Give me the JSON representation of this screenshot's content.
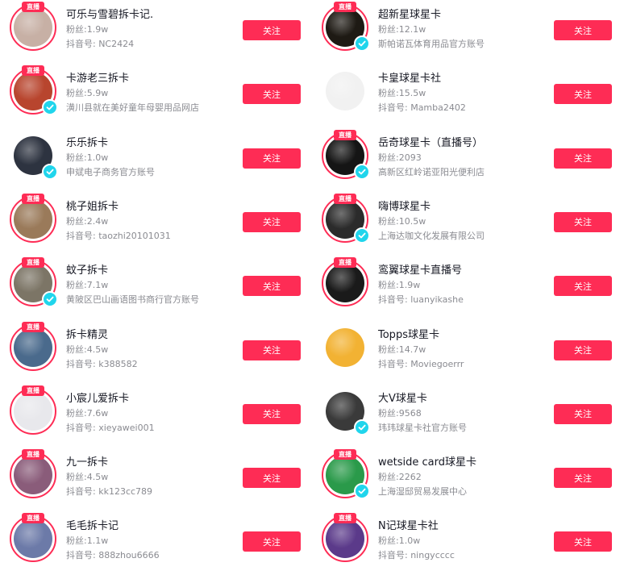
{
  "follow_label": "关注",
  "live_label": "直播",
  "left": [
    {
      "name": "可乐与雪碧拆卡记.",
      "fans": "粉丝:1.9w",
      "line3": "抖音号: NC2424",
      "live": true,
      "verified": false,
      "avatar_color": "#c7b0a5"
    },
    {
      "name": "卡游老三拆卡",
      "fans": "粉丝:5.9w",
      "line3": "潢川县就在美好童年母婴用品网店",
      "live": true,
      "verified": true,
      "avatar_color": "#b8452e"
    },
    {
      "name": "乐乐拆卡",
      "fans": "粉丝:1.0w",
      "line3": "申斌电子商务官方账号",
      "live": false,
      "verified": true,
      "avatar_color": "#2d3340"
    },
    {
      "name": "桃子姐拆卡",
      "fans": "粉丝:2.4w",
      "line3": "抖音号: taozhi20101031",
      "live": true,
      "verified": false,
      "avatar_color": "#9a7a5a"
    },
    {
      "name": "蚊子拆卡",
      "fans": "粉丝:7.1w",
      "line3": "黄陂区巴山画语图书商行官方账号",
      "live": true,
      "verified": true,
      "avatar_color": "#7c7566"
    },
    {
      "name": "拆卡精灵",
      "fans": "粉丝:4.5w",
      "line3": "抖音号: k388582",
      "live": true,
      "verified": false,
      "avatar_color": "#4a6a8c"
    },
    {
      "name": "小宸儿爱拆卡",
      "fans": "粉丝:7.6w",
      "line3": "抖音号: xieyawei001",
      "live": true,
      "verified": false,
      "avatar_color": "#e8e8ec"
    },
    {
      "name": "九一拆卡",
      "fans": "粉丝:4.5w",
      "line3": "抖音号: kk123cc789",
      "live": true,
      "verified": false,
      "avatar_color": "#8a5c7a"
    },
    {
      "name": "毛毛拆卡记",
      "fans": "粉丝:1.1w",
      "line3": "抖音号: 888zhou6666",
      "live": true,
      "verified": false,
      "avatar_color": "#6c7aa8"
    }
  ],
  "right": [
    {
      "name": "超新星球星卡",
      "fans": "粉丝:12.1w",
      "line3": "斯帕诺瓦体育用品官方账号",
      "live": true,
      "verified": true,
      "avatar_color": "#1e1a14"
    },
    {
      "name": "卡皇球星卡社",
      "fans": "粉丝:15.5w",
      "line3": "抖音号: Mamba2402",
      "live": false,
      "verified": false,
      "avatar_color": "#f1f1f1"
    },
    {
      "name": "岳奇球星卡（直播号）",
      "fans": "粉丝:2093",
      "line3": "高新区红岭诺亚阳光便利店",
      "live": true,
      "verified": true,
      "avatar_color": "#151515"
    },
    {
      "name": "嗨博球星卡",
      "fans": "粉丝:10.5w",
      "line3": "上海达咖文化发展有限公司",
      "live": true,
      "verified": true,
      "avatar_color": "#2b2b2b"
    },
    {
      "name": "鸾翼球星卡直播号",
      "fans": "粉丝:1.9w",
      "line3": "抖音号: luanyikashe",
      "live": true,
      "verified": false,
      "avatar_color": "#1a1a1a"
    },
    {
      "name": "Topps球星卡",
      "fans": "粉丝:14.7w",
      "line3": "抖音号: Moviegoerrr",
      "live": false,
      "verified": false,
      "avatar_color": "#f2b233"
    },
    {
      "name": "大V球星卡",
      "fans": "粉丝:9568",
      "line3": "玮玮球星卡社官方账号",
      "live": false,
      "verified": true,
      "avatar_color": "#3a3a3a"
    },
    {
      "name": "wetside card球星卡",
      "fans": "粉丝:2262",
      "line3": "上海湿邸贸易发展中心",
      "live": true,
      "verified": true,
      "avatar_color": "#2a9a4a"
    },
    {
      "name": "N记球星卡社",
      "fans": "粉丝:1.0w",
      "line3": "抖音号: ningycccc",
      "live": true,
      "verified": false,
      "avatar_color": "#5b3a8a"
    }
  ]
}
